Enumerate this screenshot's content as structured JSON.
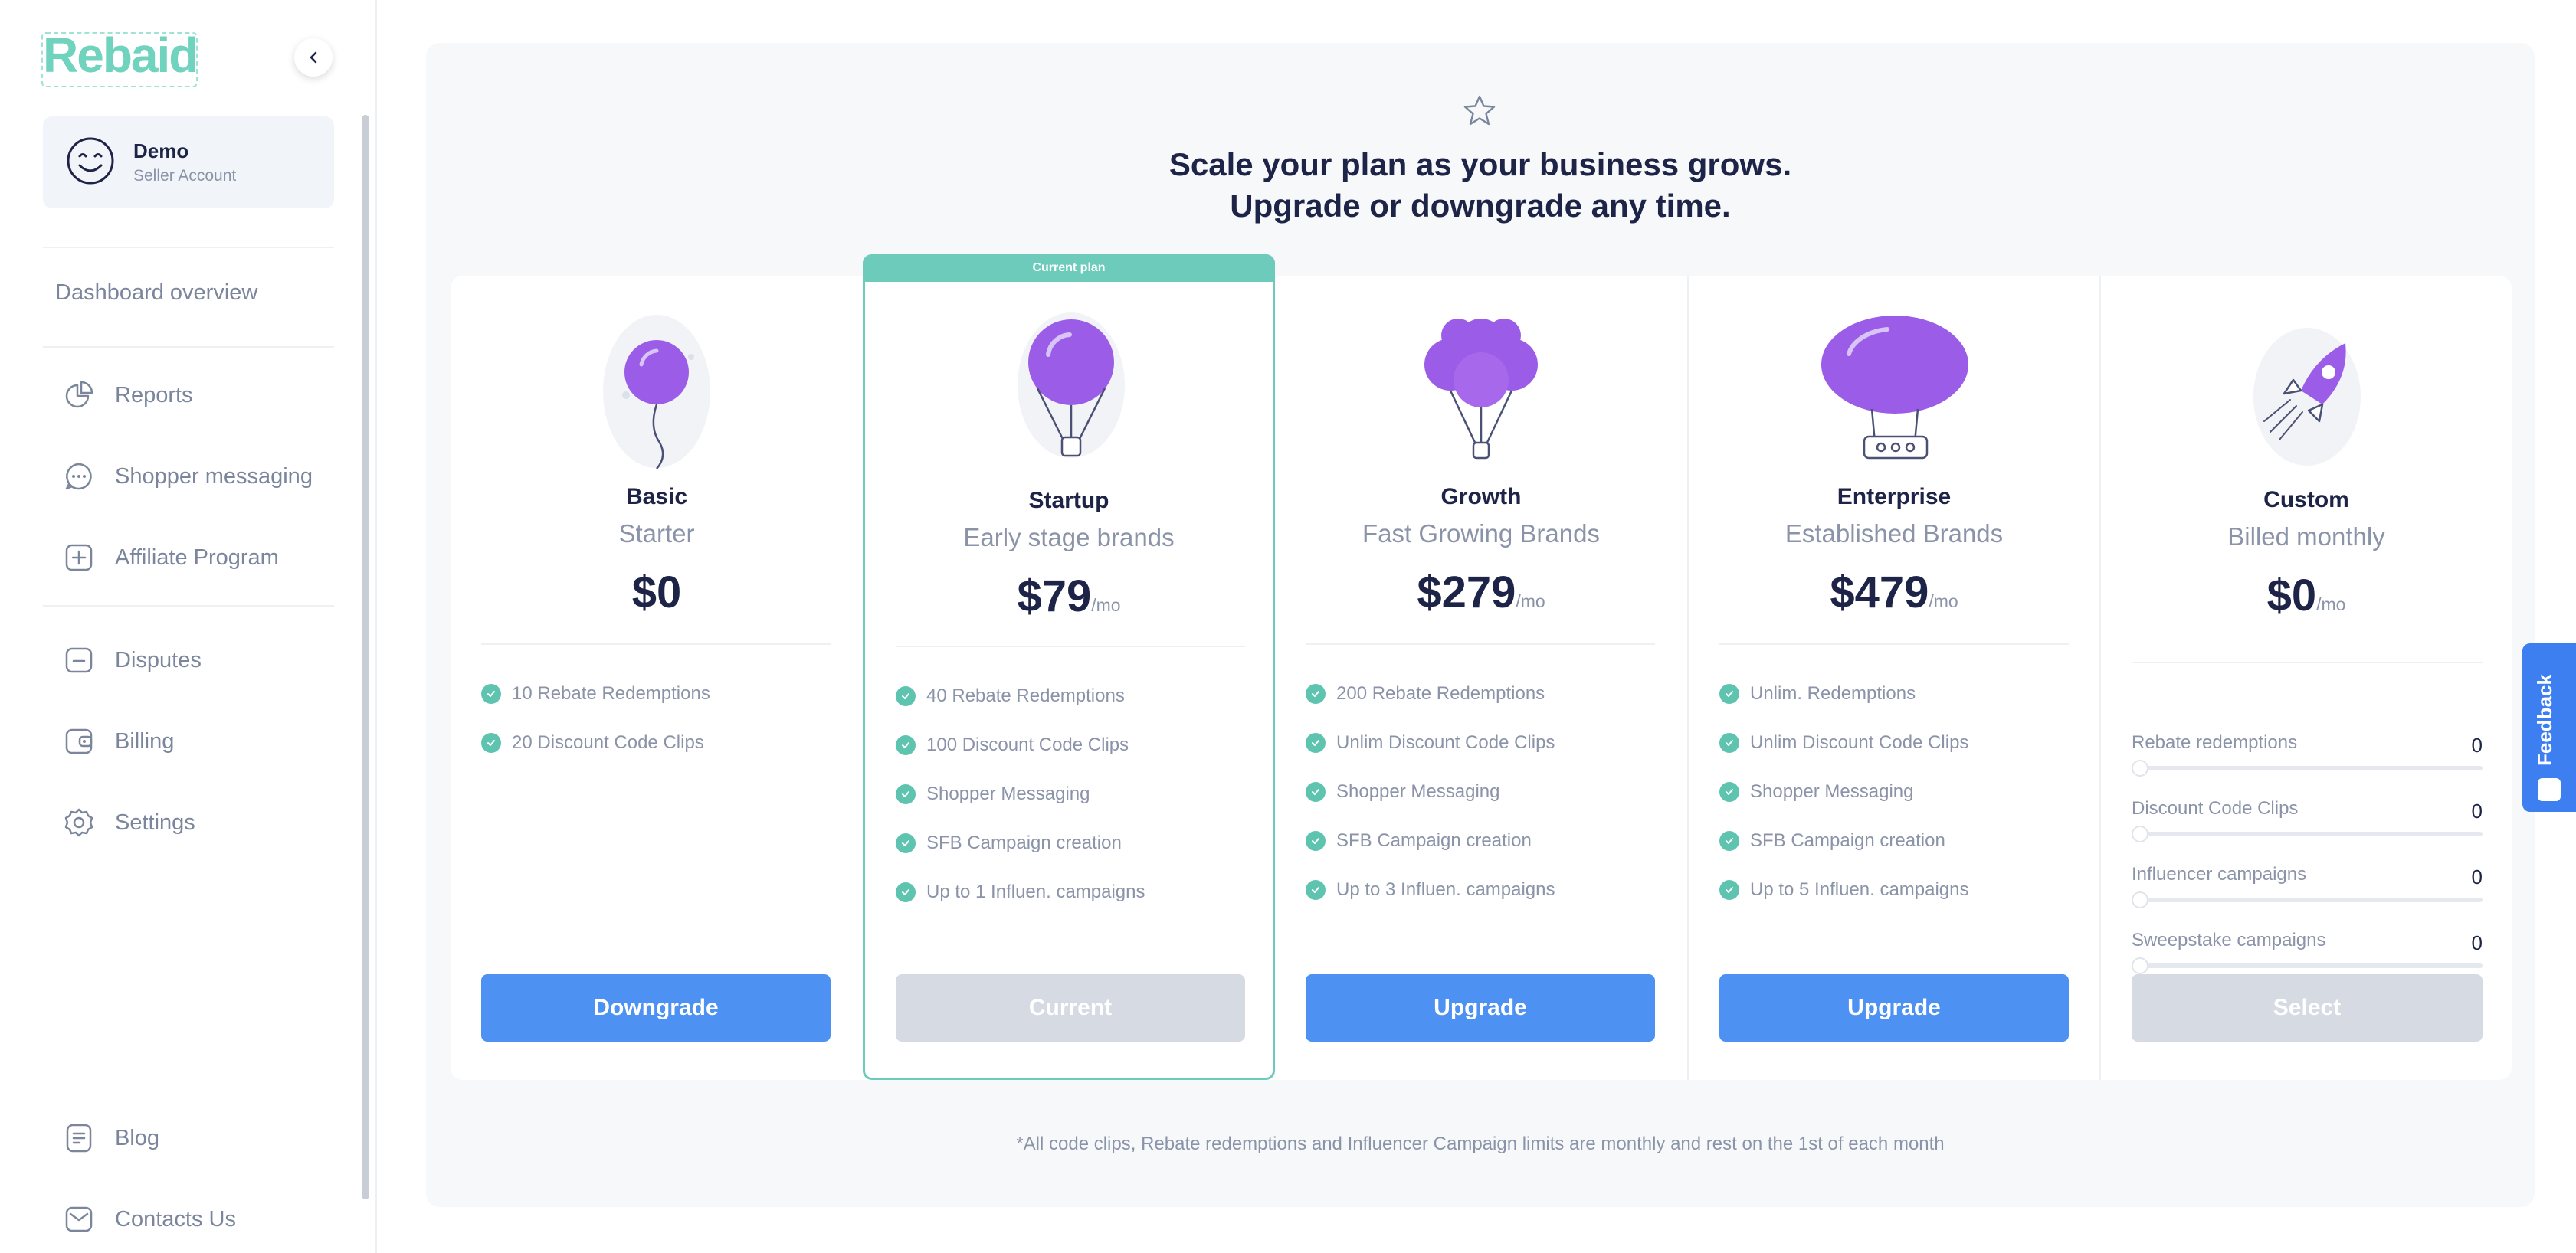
{
  "brand": {
    "name": "Rebaid",
    "accent": "#6fd3be",
    "primary_button": "#4d92f3"
  },
  "account": {
    "name": "Demo",
    "role": "Seller Account"
  },
  "sidebar": {
    "overview": "Dashboard overview",
    "items": [
      {
        "label": "Reports",
        "icon": "pie-chart-icon"
      },
      {
        "label": "Shopper messaging",
        "icon": "chat-bubble-icon"
      },
      {
        "label": "Affiliate Program",
        "icon": "plus-square-icon"
      },
      {
        "label": "Disputes",
        "icon": "folder-icon"
      },
      {
        "label": "Billing",
        "icon": "wallet-icon"
      },
      {
        "label": "Settings",
        "icon": "gear-icon"
      },
      {
        "label": "Blog",
        "icon": "document-icon"
      },
      {
        "label": "Contacts Us",
        "icon": "mail-icon"
      }
    ]
  },
  "header": {
    "line1": "Scale your plan as your business grows.",
    "line2": "Upgrade or downgrade any time."
  },
  "current_tag": "Current plan",
  "plans": [
    {
      "name": "Basic",
      "sub": "Starter",
      "price": "$0",
      "per": "",
      "features": [
        "10 Rebate Redemptions",
        "20 Discount Code Clips"
      ],
      "button": "Downgrade"
    },
    {
      "name": "Startup",
      "sub": "Early stage brands",
      "price": "$79",
      "per": "/mo",
      "features": [
        "40 Rebate Redemptions",
        "100 Discount Code Clips",
        "Shopper Messaging",
        "SFB Campaign creation",
        "Up to 1 Influen. campaigns"
      ],
      "button": "Current"
    },
    {
      "name": "Growth",
      "sub": "Fast Growing Brands",
      "price": "$279",
      "per": "/mo",
      "features": [
        "200 Rebate Redemptions",
        "Unlim Discount Code Clips",
        "Shopper Messaging",
        "SFB Campaign creation",
        "Up to 3 Influen. campaigns"
      ],
      "button": "Upgrade"
    },
    {
      "name": "Enterprise",
      "sub": "Established Brands",
      "price": "$479",
      "per": "/mo",
      "features": [
        "Unlim. Redemptions",
        "Unlim Discount Code Clips",
        "Shopper Messaging",
        "SFB Campaign creation",
        "Up to 5 Influen. campaigns"
      ],
      "button": "Upgrade"
    },
    {
      "name": "Custom",
      "sub": "Billed monthly",
      "price": "$0",
      "per": "/mo",
      "sliders": [
        {
          "label": "Rebate redemptions",
          "value": "0"
        },
        {
          "label": "Discount Code Clips",
          "value": "0"
        },
        {
          "label": "Influencer campaigns",
          "value": "0"
        },
        {
          "label": "Sweepstake campaigns",
          "value": "0"
        }
      ],
      "button": "Select"
    }
  ],
  "footnote": "*All code clips, Rebate redemptions and Influencer Campaign limits are monthly and rest on the 1st of each month",
  "feedback_label": "Feedback"
}
